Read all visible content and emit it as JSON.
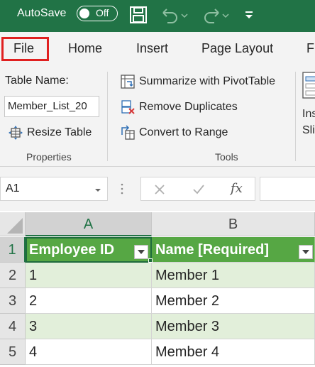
{
  "titlebar": {
    "autosave_label": "AutoSave",
    "autosave_state": "Off",
    "icons": [
      "save-icon",
      "undo-icon",
      "redo-icon",
      "customize-quick-access-icon"
    ]
  },
  "tabs": [
    "File",
    "Home",
    "Insert",
    "Page Layout",
    "F"
  ],
  "ribbon": {
    "properties": {
      "table_name_label": "Table Name:",
      "table_name_value": "Member_List_20",
      "resize_label": "Resize Table",
      "group_label": "Properties"
    },
    "tools": {
      "summarize_label": "Summarize with PivotTable",
      "remove_dup_label": "Remove Duplicates",
      "convert_label": "Convert to Range",
      "group_label": "Tools"
    },
    "insert_slicer_partial": [
      "Ins",
      "Sli"
    ]
  },
  "formula_bar": {
    "name_box": "A1",
    "fx_label": "fx"
  },
  "grid": {
    "columns": [
      "A",
      "B"
    ],
    "headers": [
      "Employee ID",
      "Name [Required]"
    ],
    "rows": [
      {
        "num": "1"
      },
      {
        "num": "2",
        "id": "1",
        "name": "Member 1"
      },
      {
        "num": "3",
        "id": "2",
        "name": "Member 2"
      },
      {
        "num": "4",
        "id": "3",
        "name": "Member 3"
      },
      {
        "num": "5",
        "id": "4",
        "name": "Member 4"
      }
    ]
  },
  "colors": {
    "excel_green": "#217346",
    "header_green": "#56a744",
    "band_green": "#e2efda",
    "highlight_red": "#e02020"
  }
}
